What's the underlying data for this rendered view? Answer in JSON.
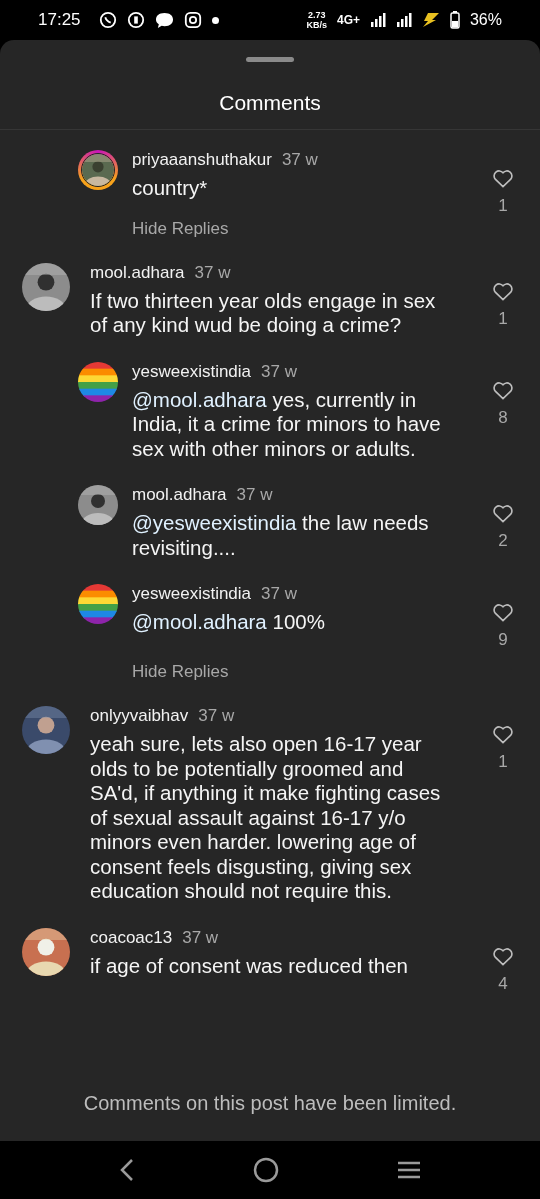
{
  "status_bar": {
    "time": "17:25",
    "speed_value": "2.73",
    "speed_unit": "KB/s",
    "network": "4G+",
    "battery": "36%"
  },
  "sheet": {
    "title": "Comments"
  },
  "comments": [
    {
      "kind": "reply",
      "avatar": {
        "kind": "picture",
        "story_ring": true
      },
      "username": "priyaaanshuthakur",
      "time": "37 w",
      "text": "country*",
      "likes": "1",
      "hide_replies": "Hide Replies"
    },
    {
      "kind": "comment",
      "avatar": {
        "kind": "picture"
      },
      "username": "mool.adhara",
      "time": "37 w",
      "text": "If two thirteen year olds engage in sex of any kind wud be doing a crime?",
      "likes": "1",
      "hide_replies": "Hide Replies",
      "replies": [
        {
          "kind": "reply",
          "avatar": {
            "kind": "picture"
          },
          "username": "yesweexistindia",
          "time": "37 w",
          "mention": "@mool.adhara",
          "text": "yes, currently in India, it a crime for minors to have sex with other minors or adults.",
          "likes": "8"
        },
        {
          "kind": "reply",
          "avatar": {
            "kind": "picture"
          },
          "username": "mool.adhara",
          "time": "37 w",
          "mention": "@yesweexistindia",
          "text": " the law needs revisiting....",
          "likes": "2"
        },
        {
          "kind": "reply",
          "avatar": {
            "kind": "picture"
          },
          "username": "yesweexistindia",
          "time": "37 w",
          "mention": "@mool.adhara",
          "text": "100%",
          "likes": "9"
        }
      ]
    },
    {
      "kind": "comment",
      "avatar": {
        "kind": "picture"
      },
      "username": "onlyyvaibhav",
      "time": "37 w",
      "text": "yeah sure, lets also open 16-17 year olds to be potentially groomed and SA'd, if anything it make fighting cases of sexual assault against 16-17 y/o minors even harder. lowering age of consent feels disgusting, giving sex education should not require this.",
      "likes": "1"
    },
    {
      "kind": "comment",
      "avatar": {
        "kind": "picture"
      },
      "username": "coacoac13",
      "time": "37 w",
      "text": "if age of consent was reduced then",
      "likes": "4"
    }
  ],
  "footer": {
    "notice": "Comments on this post have been limited."
  }
}
